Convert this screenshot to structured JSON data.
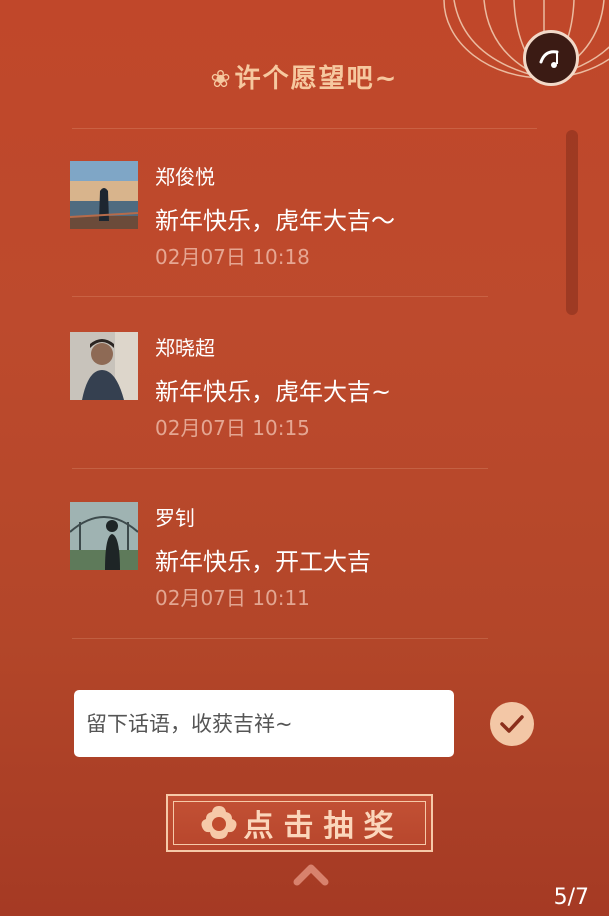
{
  "header": {
    "title": "许个愿望吧~",
    "flower_icon": "❀"
  },
  "wishes": [
    {
      "name": "郑俊悦",
      "message": "新年快乐，虎年大吉～",
      "time": "02月07日 10:18",
      "avatar": "seaside-avatar"
    },
    {
      "name": "郑晓超",
      "message": "新年快乐，虎年大吉~",
      "time": "02月07日 10:15",
      "avatar": "portrait-avatar"
    },
    {
      "name": "罗钊",
      "message": "新年快乐，开工大吉",
      "time": "02月07日 10:11",
      "avatar": "silhouette-avatar"
    }
  ],
  "composer": {
    "placeholder": "留下话语，收获吉祥~",
    "value": ""
  },
  "draw_button": {
    "label": "点击抽奖"
  },
  "pager": {
    "current": 5,
    "total": 7,
    "text": "5/7"
  },
  "colors": {
    "background": "#bd4a2d",
    "accent": "#f6c89f",
    "button_border": "#f6c9a8"
  }
}
